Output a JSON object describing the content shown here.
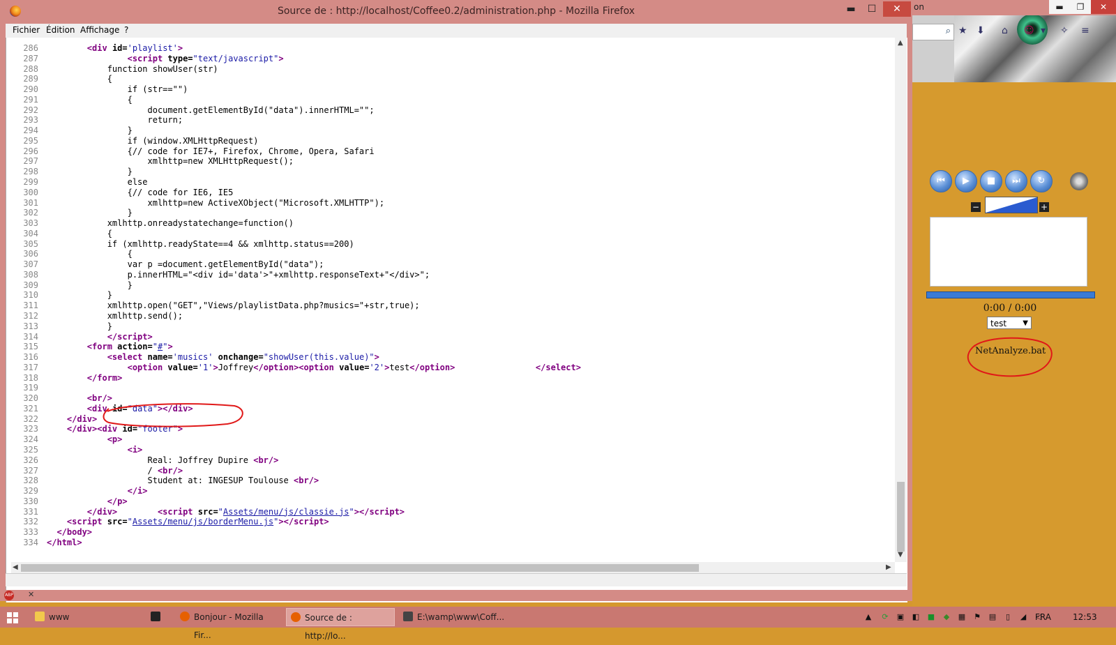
{
  "window": {
    "title": "Source de : http://localhost/Coffee0.2/administration.php - Mozilla Firefox",
    "minimize": "▬",
    "maximize": "☐",
    "close": "✕"
  },
  "menu": [
    "Fichier",
    "Édition",
    "Affichage",
    "?"
  ],
  "code_lines": [
    {
      "n": "286",
      "html": "        <span class='tag'>&lt;div</span> <span class='atn'>id=</span><span class='atv'>'playlist'</span><span class='tag'>&gt;</span>"
    },
    {
      "n": "287",
      "html": "                <span class='tag'>&lt;script</span> <span class='atn'>type=</span><span class='atv'>\"text/javascript\"</span><span class='tag'>&gt;</span>"
    },
    {
      "n": "288",
      "html": "            function showUser(str)"
    },
    {
      "n": "289",
      "html": "            {"
    },
    {
      "n": "290",
      "html": "                if (str==\"\")"
    },
    {
      "n": "291",
      "html": "                {"
    },
    {
      "n": "292",
      "html": "                    document.getElementById(\"data\").innerHTML=\"\";"
    },
    {
      "n": "293",
      "html": "                    return;"
    },
    {
      "n": "294",
      "html": "                }"
    },
    {
      "n": "295",
      "html": "                if (window.XMLHttpRequest)"
    },
    {
      "n": "296",
      "html": "                {// code for IE7+, Firefox, Chrome, Opera, Safari"
    },
    {
      "n": "297",
      "html": "                    xmlhttp=new XMLHttpRequest();"
    },
    {
      "n": "298",
      "html": "                }"
    },
    {
      "n": "299",
      "html": "                else"
    },
    {
      "n": "300",
      "html": "                {// code for IE6, IE5"
    },
    {
      "n": "301",
      "html": "                    xmlhttp=new ActiveXObject(\"Microsoft.XMLHTTP\");"
    },
    {
      "n": "302",
      "html": "                }"
    },
    {
      "n": "303",
      "html": "            xmlhttp.onreadystatechange=function()"
    },
    {
      "n": "304",
      "html": "            {"
    },
    {
      "n": "305",
      "html": "            if (xmlhttp.readyState==4 &amp;&amp; xmlhttp.status==200)"
    },
    {
      "n": "306",
      "html": "                {"
    },
    {
      "n": "307",
      "html": "                var p =document.getElementById(\"data\");"
    },
    {
      "n": "308",
      "html": "                p.innerHTML=\"&lt;div id='data'&gt;\"+xmlhttp.responseText+\"&lt;/div&gt;\";"
    },
    {
      "n": "309",
      "html": "                }"
    },
    {
      "n": "310",
      "html": "            }"
    },
    {
      "n": "311",
      "html": "            xmlhttp.open(\"GET\",\"Views/playlistData.php?musics=\"+str,true);"
    },
    {
      "n": "312",
      "html": "            xmlhttp.send();"
    },
    {
      "n": "313",
      "html": "            }"
    },
    {
      "n": "314",
      "html": "            <span class='tag'>&lt;/script&gt;</span>"
    },
    {
      "n": "315",
      "html": "        <span class='tag'>&lt;form</span> <span class='atn'>action=</span><span class='atv'>\"<span class='lnk'>#</span>\"</span><span class='tag'>&gt;</span>"
    },
    {
      "n": "316",
      "html": "            <span class='tag'>&lt;select</span> <span class='atn'>name=</span><span class='atv'>'musics'</span> <span class='atn'>onchange=</span><span class='atv'>\"showUser(this.value)\"</span><span class='tag'>&gt;</span>"
    },
    {
      "n": "317",
      "html": "                <span class='tag'>&lt;option</span> <span class='atn'>value=</span><span class='atv'>'1'</span><span class='tag'>&gt;</span>Joffrey<span class='tag'>&lt;/option&gt;&lt;option</span> <span class='atn'>value=</span><span class='atv'>'2'</span><span class='tag'>&gt;</span>test<span class='tag'>&lt;/option&gt;</span>                <span class='tag'>&lt;/select&gt;</span>"
    },
    {
      "n": "318",
      "html": "        <span class='tag'>&lt;/form&gt;</span>"
    },
    {
      "n": "319",
      "html": ""
    },
    {
      "n": "320",
      "html": "        <span class='tag'>&lt;br/&gt;</span>"
    },
    {
      "n": "321",
      "html": "        <span class='tag'>&lt;div</span> <span class='atn'>id=</span><span class='atv'>\"data\"</span><span class='tag'>&gt;&lt;/div&gt;</span>"
    },
    {
      "n": "322",
      "html": "    <span class='tag'>&lt;/div&gt;</span>"
    },
    {
      "n": "323",
      "html": "    <span class='tag'>&lt;/div&gt;&lt;div</span> <span class='atn'>id=</span><span class='atv'>\"footer\"</span><span class='tag'>&gt;</span>"
    },
    {
      "n": "324",
      "html": "            <span class='tag'>&lt;p&gt;</span>"
    },
    {
      "n": "325",
      "html": "                <span class='tag'>&lt;i&gt;</span>"
    },
    {
      "n": "326",
      "html": "                    Real: Joffrey Dupire <span class='tag'>&lt;br/&gt;</span>"
    },
    {
      "n": "327",
      "html": "                    / <span class='tag'>&lt;br/&gt;</span>"
    },
    {
      "n": "328",
      "html": "                    Student at: INGESUP Toulouse <span class='tag'>&lt;br/&gt;</span>"
    },
    {
      "n": "329",
      "html": "                <span class='tag'>&lt;/i&gt;</span>"
    },
    {
      "n": "330",
      "html": "            <span class='tag'>&lt;/p&gt;</span>"
    },
    {
      "n": "331",
      "html": "        <span class='tag'>&lt;/div&gt;</span>        <span class='tag'>&lt;script</span> <span class='atn'>src=</span><span class='atv'>\"<span class='lnk'>Assets/menu/js/classie.js</span>\"</span><span class='tag'>&gt;&lt;/script&gt;</span>"
    },
    {
      "n": "332",
      "html": "    <span class='tag'>&lt;script</span> <span class='atn'>src=</span><span class='atv'>\"<span class='lnk'>Assets/menu/js/borderMenu.js</span>\"</span><span class='tag'>&gt;&lt;/script&gt;</span>"
    },
    {
      "n": "333",
      "html": "  <span class='tag'>&lt;/body&gt;</span>"
    },
    {
      "n": "334",
      "html": "<span class='tag'>&lt;/html&gt;</span>"
    }
  ],
  "background_window": {
    "tab_fragment": "on",
    "player": {
      "buttons": [
        "previous-icon",
        "play-icon",
        "stop-icon",
        "next-icon",
        "repeat-icon"
      ],
      "time": "0:00 / 0:00",
      "playlist_selected": "test",
      "file_label": "NetAnalyze.bat",
      "volume_minus": "−",
      "volume_plus": "+"
    }
  },
  "taskbar": {
    "items": [
      {
        "label": "www",
        "icon": "folder-icon",
        "color": "#f2c94c",
        "active": false
      },
      {
        "label": "",
        "icon": "cmd-icon",
        "color": "#222222",
        "active": false
      },
      {
        "label": "Bonjour - Mozilla Fir...",
        "icon": "firefox-icon",
        "color": "#e66000",
        "active": false
      },
      {
        "label": "Source de : http://lo...",
        "icon": "firefox-icon",
        "color": "#e66000",
        "active": true
      },
      {
        "label": "E:\\wamp\\www\\Coff...",
        "icon": "window-icon",
        "color": "#444444",
        "active": false
      }
    ],
    "language": "FRA",
    "clock": "12:53"
  },
  "colors": {
    "window_frame": "#d48b86",
    "desktop": "#d69a2e",
    "annotation_red": "#e01818"
  }
}
